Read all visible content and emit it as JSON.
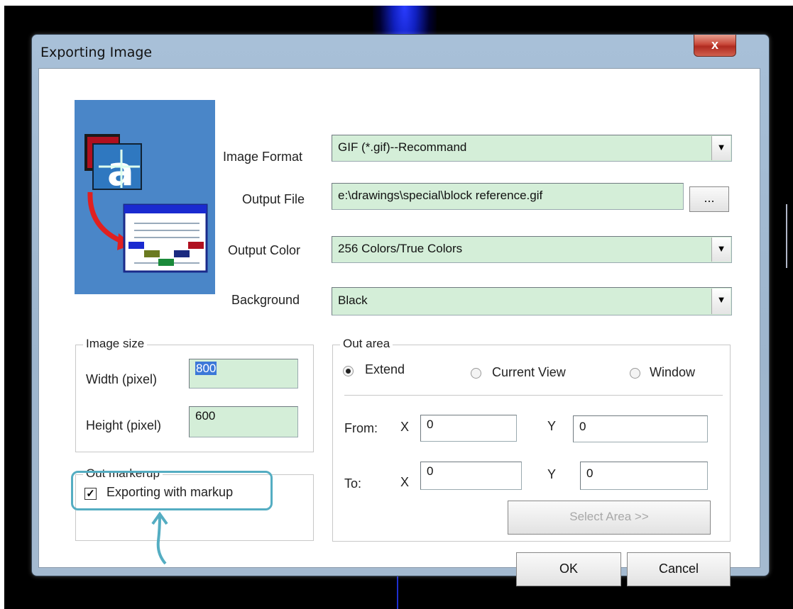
{
  "dialog": {
    "title": "Exporting Image",
    "close_glyph": "x"
  },
  "format": {
    "image_format_label": "Image Format",
    "image_format_value": "GIF (*.gif)--Recommand",
    "output_file_label": "Output File",
    "output_file_value": "e:\\drawings\\special\\block reference.gif",
    "browse_label": "...",
    "output_color_label": "Output Color",
    "output_color_value": "256 Colors/True Colors",
    "background_label": "Background",
    "background_value": "Black"
  },
  "image_size": {
    "title": "Image size",
    "width_label": "Width (pixel)",
    "width_value": "800",
    "height_label": "Height (pixel)",
    "height_value": "600"
  },
  "markup": {
    "title": "Out markerup",
    "checkbox_label": "Exporting with markup",
    "checked": true,
    "check_glyph": "✓"
  },
  "out_area": {
    "title": "Out area",
    "options": [
      "Extend",
      "Current View",
      "Window"
    ],
    "selected": "Extend",
    "from_label": "From:",
    "to_label": "To:",
    "x_label": "X",
    "y_label": "Y",
    "from_x": "0",
    "from_y": "0",
    "to_x": "0",
    "to_y": "0",
    "select_area_label": "Select  Area  >>"
  },
  "actions": {
    "ok_label": "OK",
    "cancel_label": "Cancel"
  },
  "icons": [
    "close-icon",
    "dropdown-arrow-icon",
    "export-image-logo",
    "arrow-up-annotation-icon"
  ],
  "colors": {
    "field_bg": "#d4eed8",
    "logo_bg": "#4a86c8",
    "highlight": "#54adc2"
  }
}
